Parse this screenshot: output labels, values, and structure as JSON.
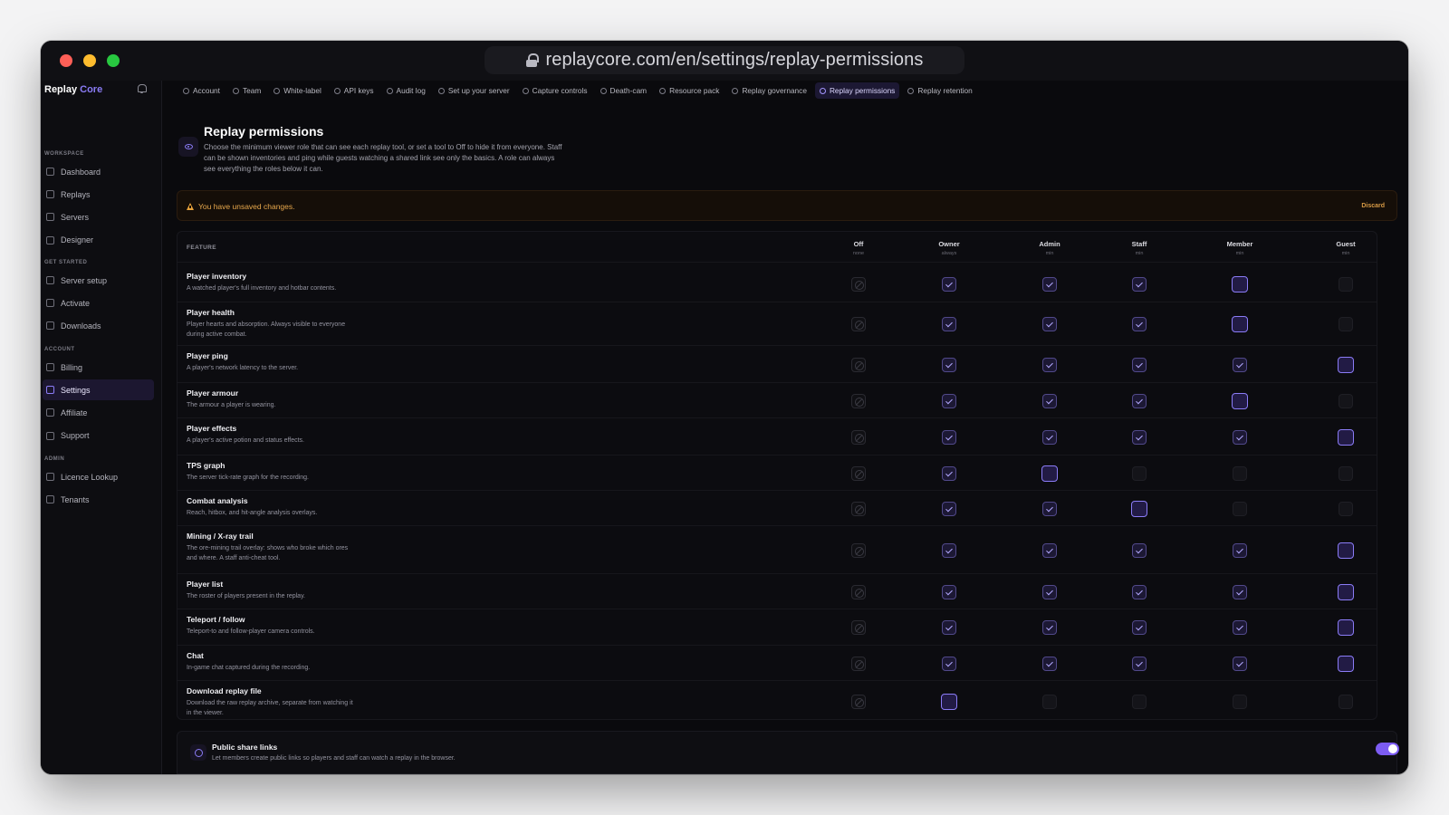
{
  "browser": {
    "url": "replaycore.com/en/settings/replay-permissions"
  },
  "brand": {
    "name": "Replay",
    "accent": "Core",
    "accent_color": "#8b7cf6"
  },
  "sidebar": {
    "sections": [
      {
        "label": "WORKSPACE",
        "items": [
          {
            "label": "Dashboard",
            "icon": "grid-icon"
          },
          {
            "label": "Replays",
            "icon": "play-icon"
          },
          {
            "label": "Servers",
            "icon": "server-icon"
          },
          {
            "label": "Designer",
            "icon": "brush-icon"
          }
        ]
      },
      {
        "label": "GET STARTED",
        "items": [
          {
            "label": "Server setup",
            "icon": "key-icon"
          },
          {
            "label": "Activate",
            "icon": "shield-icon"
          },
          {
            "label": "Downloads",
            "icon": "download-icon"
          }
        ]
      },
      {
        "label": "ACCOUNT",
        "items": [
          {
            "label": "Billing",
            "icon": "card-icon"
          },
          {
            "label": "Settings",
            "icon": "gear-icon",
            "active": true
          },
          {
            "label": "Affiliate",
            "icon": "tag-icon"
          },
          {
            "label": "Support",
            "icon": "help-icon"
          }
        ]
      },
      {
        "label": "ADMIN",
        "items": [
          {
            "label": "Licence Lookup",
            "icon": "search-icon"
          },
          {
            "label": "Tenants",
            "icon": "users-icon"
          }
        ]
      }
    ]
  },
  "tabs": [
    {
      "label": "Account",
      "icon": "user-icon"
    },
    {
      "label": "Team",
      "icon": "users-icon"
    },
    {
      "label": "White-label",
      "icon": "brush-icon"
    },
    {
      "label": "API keys",
      "icon": "key-icon"
    },
    {
      "label": "Audit log",
      "icon": "clipboard-icon"
    },
    {
      "label": "Set up your server",
      "icon": "key-icon"
    },
    {
      "label": "Capture controls",
      "icon": "camera-icon"
    },
    {
      "label": "Death-cam",
      "icon": "refresh-icon"
    },
    {
      "label": "Resource pack",
      "icon": "layers-icon"
    },
    {
      "label": "Replay governance",
      "icon": "shield-icon"
    },
    {
      "label": "Replay permissions",
      "icon": "eye-icon",
      "active": true
    },
    {
      "label": "Replay retention",
      "icon": "clock-icon"
    }
  ],
  "header": {
    "title": "Replay permissions",
    "description": "Choose the minimum viewer role that can see each replay tool, or set a tool to Off to hide it from everyone. Staff can be shown inventories and ping while guests watching a shared link see only the basics. A role can always see everything the roles below it can."
  },
  "banner": {
    "text": "You have unsaved changes.",
    "discard": "Discard"
  },
  "table": {
    "feature_header": "FEATURE",
    "columns": [
      {
        "name": "Off",
        "sub": "none"
      },
      {
        "name": "Owner",
        "sub": "always"
      },
      {
        "name": "Admin",
        "sub": "min"
      },
      {
        "name": "Staff",
        "sub": "min"
      },
      {
        "name": "Member",
        "sub": "min"
      },
      {
        "name": "Guest",
        "sub": "min"
      }
    ],
    "rows": [
      {
        "title": "Player inventory",
        "desc": "A watched player's full inventory and hotbar contents.",
        "cells": [
          "off",
          "on",
          "on",
          "on",
          "min",
          "empty"
        ]
      },
      {
        "title": "Player health",
        "desc": "Player hearts and absorption. Always visible to everyone during active combat.",
        "cells": [
          "off",
          "on",
          "on",
          "on",
          "min",
          "empty"
        ]
      },
      {
        "title": "Player ping",
        "desc": "A player's network latency to the server.",
        "cells": [
          "off",
          "on",
          "on",
          "on",
          "on",
          "min"
        ]
      },
      {
        "title": "Player armour",
        "desc": "The armour a player is wearing.",
        "cells": [
          "off",
          "on",
          "on",
          "on",
          "min",
          "empty"
        ]
      },
      {
        "title": "Player effects",
        "desc": "A player's active potion and status effects.",
        "cells": [
          "off",
          "on",
          "on",
          "on",
          "on",
          "min"
        ]
      },
      {
        "title": "TPS graph",
        "desc": "The server tick-rate graph for the recording.",
        "cells": [
          "off",
          "on",
          "min",
          "empty",
          "empty",
          "empty"
        ]
      },
      {
        "title": "Combat analysis",
        "desc": "Reach, hitbox, and hit-angle analysis overlays.",
        "cells": [
          "off",
          "on",
          "on",
          "min",
          "empty",
          "empty"
        ]
      },
      {
        "title": "Mining / X-ray trail",
        "desc": "The ore-mining trail overlay: shows who broke which ores and where. A staff anti-cheat tool.",
        "cells": [
          "off",
          "on",
          "on",
          "on",
          "on",
          "min"
        ]
      },
      {
        "title": "Player list",
        "desc": "The roster of players present in the replay.",
        "cells": [
          "off",
          "on",
          "on",
          "on",
          "on",
          "min"
        ]
      },
      {
        "title": "Teleport / follow",
        "desc": "Teleport-to and follow-player camera controls.",
        "cells": [
          "off",
          "on",
          "on",
          "on",
          "on",
          "min"
        ]
      },
      {
        "title": "Chat",
        "desc": "In-game chat captured during the recording.",
        "cells": [
          "off",
          "on",
          "on",
          "on",
          "on",
          "min"
        ]
      },
      {
        "title": "Download replay file",
        "desc": "Download the raw replay archive, separate from watching it in the viewer.",
        "cells": [
          "off",
          "min",
          "empty",
          "empty",
          "empty",
          "empty"
        ]
      }
    ]
  },
  "share": {
    "title": "Public share links",
    "desc": "Let members create public links so players and staff can watch a replay in the browser.",
    "enabled": true
  }
}
